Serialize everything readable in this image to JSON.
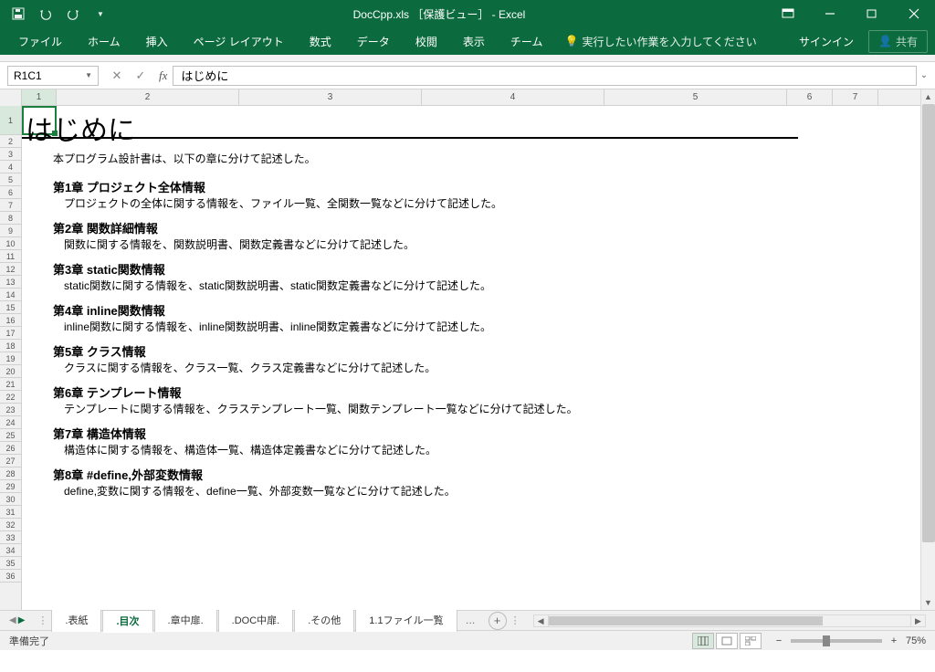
{
  "title": "DocCpp.xls ［保護ビュー］ - Excel",
  "ribbon": {
    "tabs": [
      "ファイル",
      "ホーム",
      "挿入",
      "ページ レイアウト",
      "数式",
      "データ",
      "校閲",
      "表示",
      "チーム"
    ],
    "tellme_placeholder": "実行したい作業を入力してください",
    "signin": "サインイン",
    "share": "共有"
  },
  "formula": {
    "namebox": "R1C1",
    "value": "はじめに"
  },
  "columns": [
    "1",
    "2",
    "3",
    "4",
    "5",
    "6",
    "7"
  ],
  "rows_count": 36,
  "cell_title": "はじめに",
  "doc": {
    "intro": "本プログラム設計書は、以下の章に分けて記述した。",
    "chapters": [
      {
        "h": "第1章  プロジェクト全体情報",
        "d": "プロジェクトの全体に関する情報を、ファイル一覧、全関数一覧などに分けて記述した。"
      },
      {
        "h": "第2章  関数詳細情報",
        "d": "関数に関する情報を、関数説明書、関数定義書などに分けて記述した。"
      },
      {
        "h": "第3章  static関数情報",
        "d": "static関数に関する情報を、static関数説明書、static関数定義書などに分けて記述した。"
      },
      {
        "h": "第4章  inline関数情報",
        "d": "inline関数に関する情報を、inline関数説明書、inline関数定義書などに分けて記述した。"
      },
      {
        "h": "第5章  クラス情報",
        "d": "クラスに関する情報を、クラス一覧、クラス定義書などに分けて記述した。"
      },
      {
        "h": "第6章  テンプレート情報",
        "d": "テンプレートに関する情報を、クラステンプレート一覧、関数テンプレート一覧などに分けて記述した。"
      },
      {
        "h": "第7章  構造体情報",
        "d": "構造体に関する情報を、構造体一覧、構造体定義書などに分けて記述した。"
      },
      {
        "h": "第8章  #define,外部変数情報",
        "d": "define,変数に関する情報を、define一覧、外部変数一覧などに分けて記述した。"
      }
    ]
  },
  "sheet_tabs": [
    ".表紙",
    ".目次",
    ".章中扉.",
    ".DOC中扉.",
    ".その他",
    "1.1ファイル一覧"
  ],
  "active_tab_index": 1,
  "status": {
    "ready": "準備完了",
    "zoom": "75%"
  }
}
